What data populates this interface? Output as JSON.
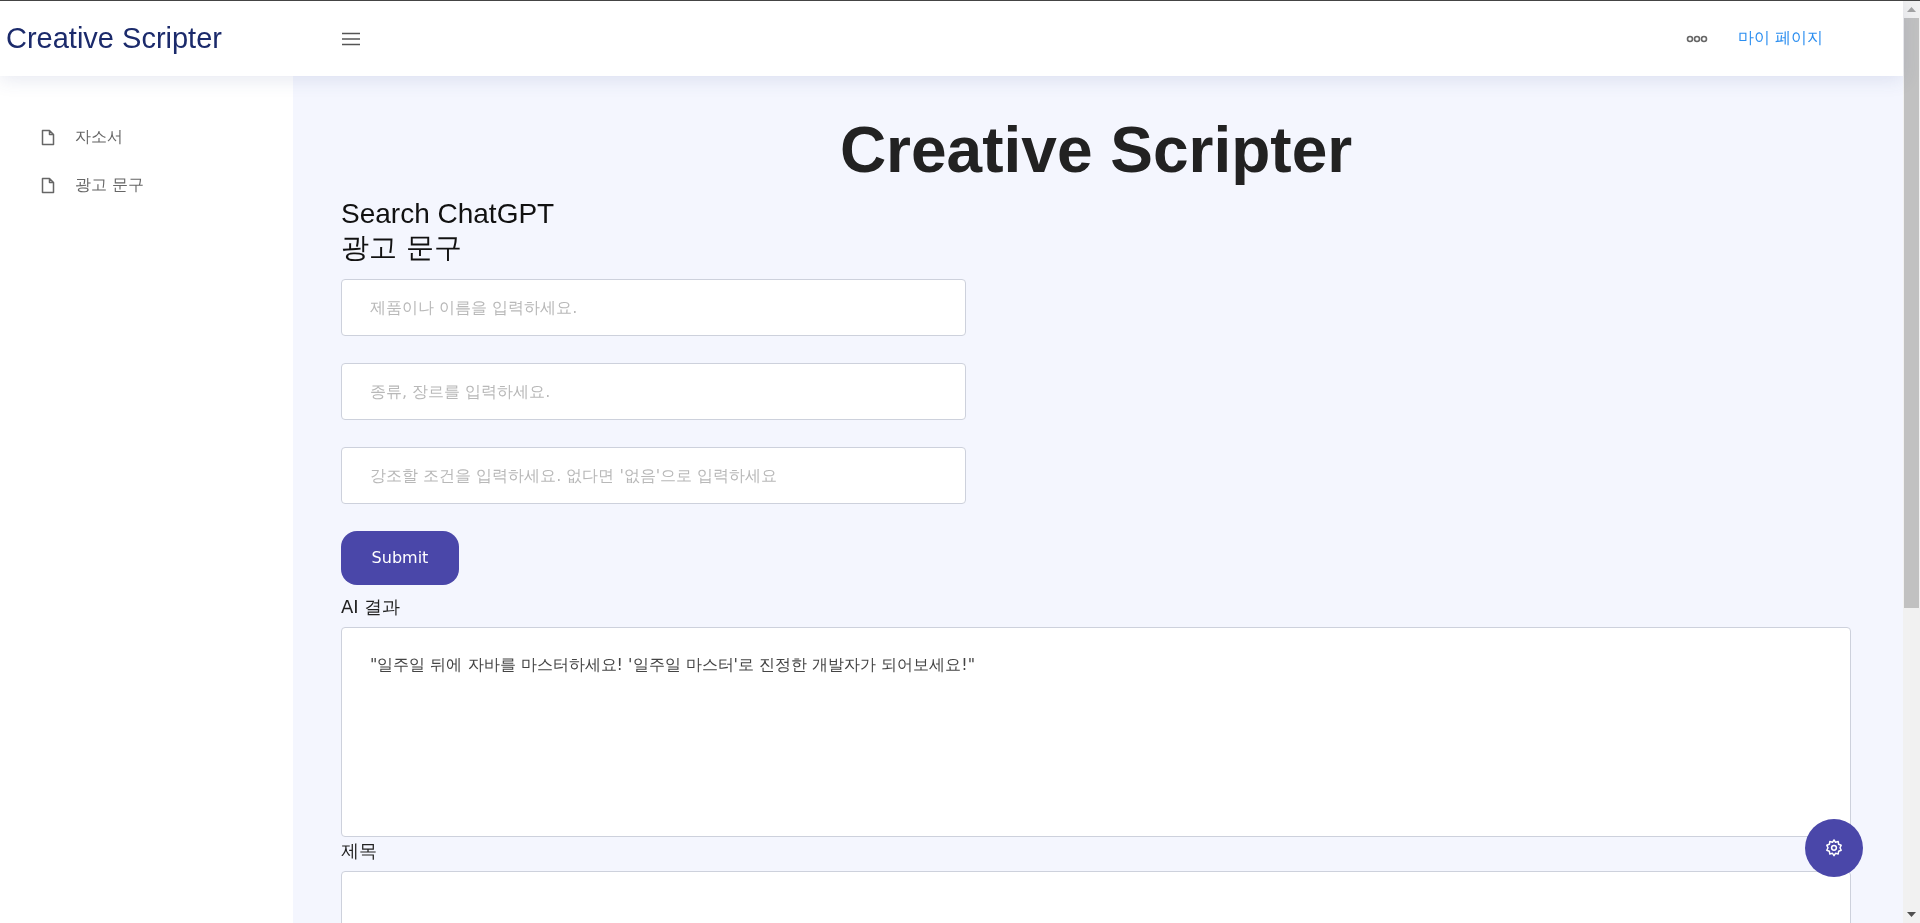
{
  "header": {
    "brand": "Creative Scripter",
    "link": "마이 페이지"
  },
  "sidebar": {
    "items": [
      {
        "label": "자소서"
      },
      {
        "label": "광고 문구"
      }
    ]
  },
  "main": {
    "title": "Creative Scripter",
    "subtitle": "Search ChatGPT",
    "section": "광고 문구",
    "fields": [
      {
        "placeholder": "제품이나 이름을 입력하세요."
      },
      {
        "placeholder": "종류, 장르를 입력하세요."
      },
      {
        "placeholder": "강조할 조건을 입력하세요. 없다면 '없음'으로 입력하세요"
      }
    ],
    "submit": "Submit",
    "result_label": "AI 결과",
    "result": "\"일주일 뒤에 자바를 마스터하세요! '일주일 마스터'로 진정한 개발자가 되어보세요!\"",
    "title_label": "제목"
  }
}
